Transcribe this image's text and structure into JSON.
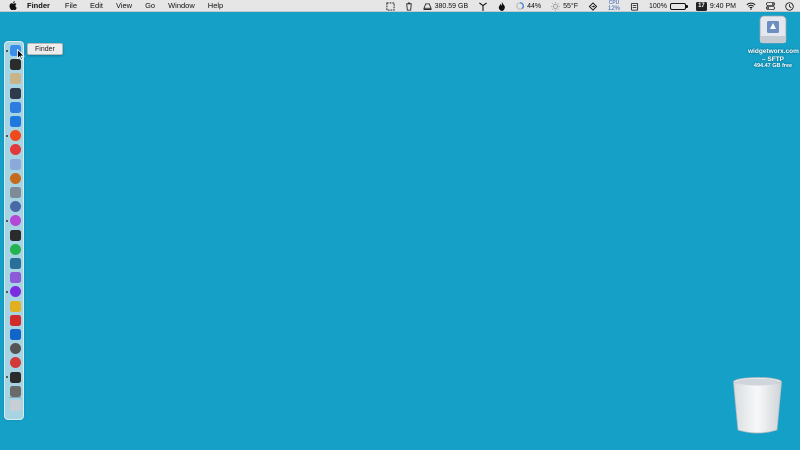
{
  "menubar": {
    "app_name": "Finder",
    "menus": [
      "File",
      "Edit",
      "View",
      "Go",
      "Window",
      "Help"
    ],
    "status": {
      "disk_free": "380.59 GB",
      "battery_pct_small": "44%",
      "temperature": "55°F",
      "cpu_label": "CPU",
      "cpu_value": "12%",
      "calendar_day": "17",
      "battery_pct": "100%",
      "battery_fraction": 1.0,
      "time": "9:40 PM"
    }
  },
  "dock": {
    "tooltip": "Finder",
    "apps": [
      {
        "name": "finder",
        "color": "#3a8ee8"
      },
      {
        "name": "activity-monitor",
        "color": "#2b2b2b"
      },
      {
        "name": "script-editor",
        "color": "#c9b48a"
      },
      {
        "name": "instruments",
        "color": "#2f3a4a"
      },
      {
        "name": "window-app",
        "color": "#2d7de0"
      },
      {
        "name": "xcode",
        "color": "#1f78e0"
      },
      {
        "name": "brave-browser",
        "color": "#f04a1c"
      },
      {
        "name": "tomato-app",
        "color": "#e23a3a"
      },
      {
        "name": "photos-app",
        "color": "#8ba9d9"
      },
      {
        "name": "cookie-app",
        "color": "#c56b1d"
      },
      {
        "name": "preview-app",
        "color": "#7f8b97"
      },
      {
        "name": "bitcoin-app",
        "color": "#4a6aa5"
      },
      {
        "name": "pink-app",
        "color": "#b349d4"
      },
      {
        "name": "terminal",
        "color": "#2a2a2a"
      },
      {
        "name": "spotify",
        "color": "#23b451"
      },
      {
        "name": "mail-app",
        "color": "#2a6f9a"
      },
      {
        "name": "purple-app",
        "color": "#8b5bd8"
      },
      {
        "name": "firefox-app",
        "color": "#7b2ce0"
      },
      {
        "name": "cyberduck-app",
        "color": "#e0b020"
      },
      {
        "name": "red-app",
        "color": "#d02a2a"
      },
      {
        "name": "outlook-app",
        "color": "#1164c8"
      },
      {
        "name": "eye-app",
        "color": "#555555"
      },
      {
        "name": "circle-app",
        "color": "#d23a3a"
      },
      {
        "name": "console-app",
        "color": "#2b2b2b"
      },
      {
        "name": "settings-app",
        "color": "#6a6a6a"
      },
      {
        "name": "downloads-stack",
        "color": "#c8ced4"
      }
    ]
  },
  "desktop": {
    "drive_label": "widgetworx.com – SFTP",
    "drive_free": "494.47 GB free"
  }
}
